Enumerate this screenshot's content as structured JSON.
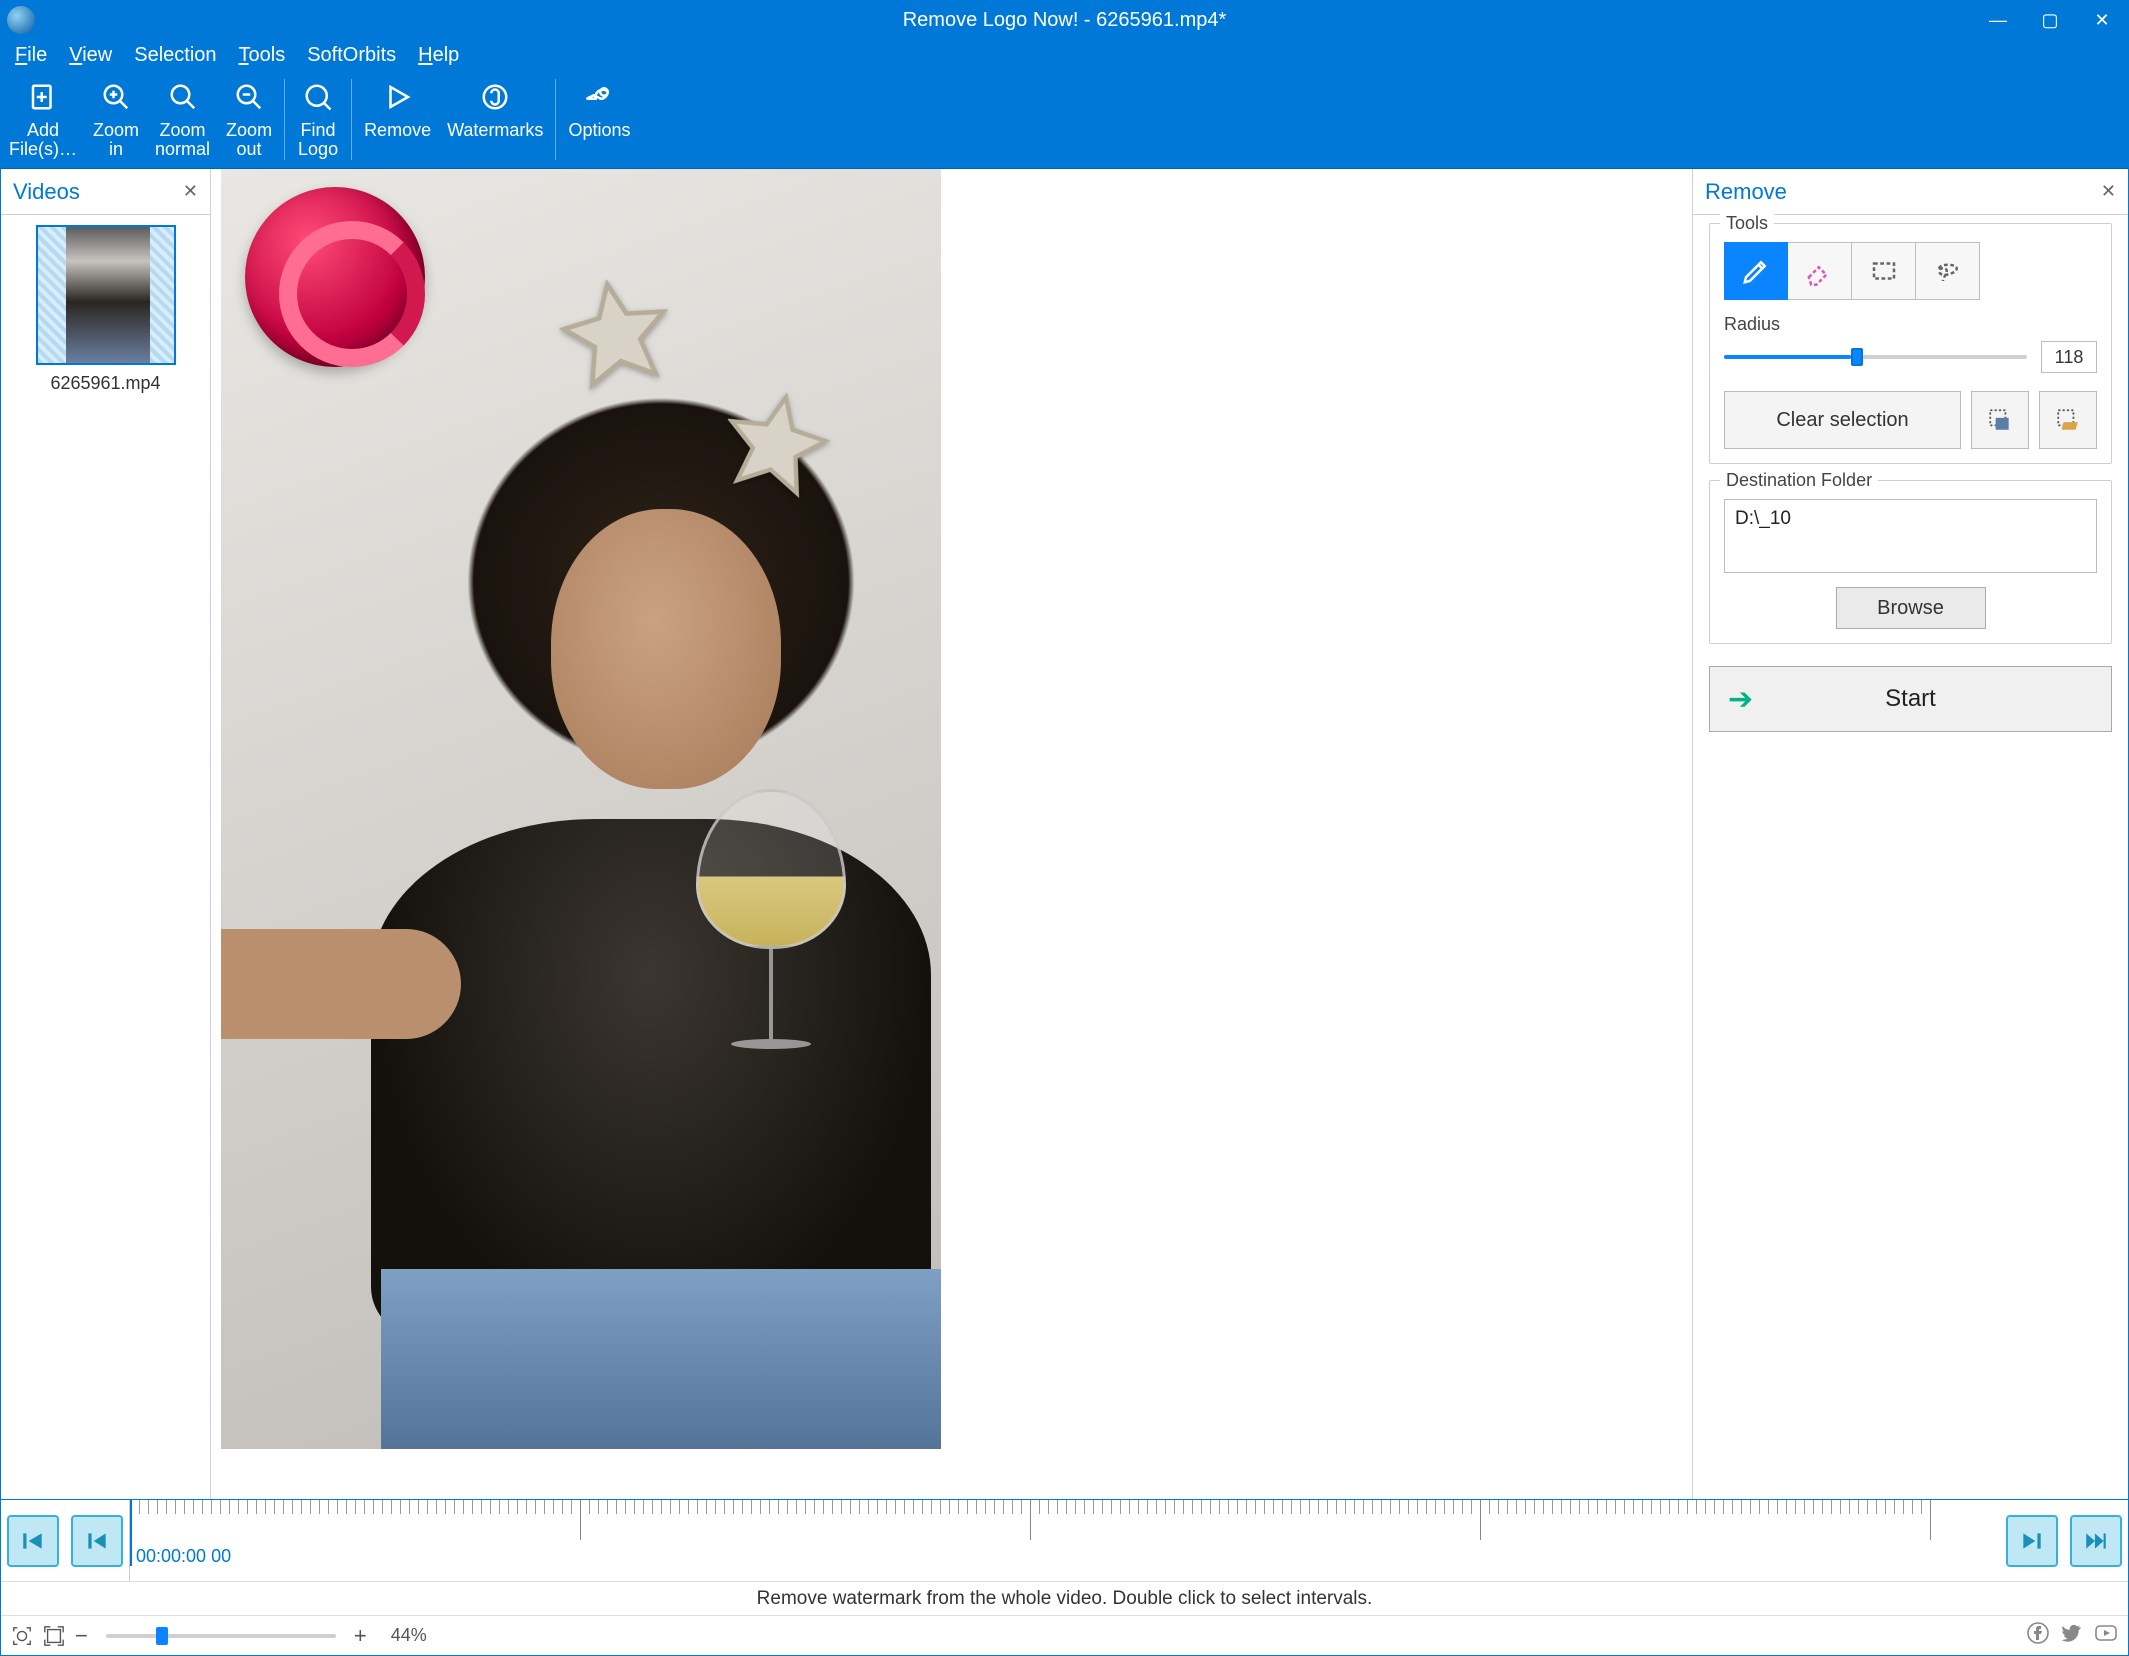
{
  "window": {
    "title": "Remove Logo Now! - 6265961.mp4*"
  },
  "menu": {
    "file": "File",
    "view": "View",
    "selection": "Selection",
    "tools": "Tools",
    "softorbits": "SoftOrbits",
    "help": "Help"
  },
  "toolbar": {
    "add_files": "Add\nFile(s)…",
    "zoom_in": "Zoom\nin",
    "zoom_normal": "Zoom\nnormal",
    "zoom_out": "Zoom\nout",
    "find_logo": "Find\nLogo",
    "remove": "Remove",
    "watermarks": "Watermarks",
    "options": "Options"
  },
  "videos": {
    "panel_title": "Videos",
    "items": [
      {
        "filename": "6265961.mp4"
      }
    ]
  },
  "remove_panel": {
    "title": "Remove",
    "tools_label": "Tools",
    "radius_label": "Radius",
    "radius_value": "118",
    "radius_percent": 42,
    "clear_selection": "Clear selection",
    "dest_label": "Destination Folder",
    "dest_path": "D:\\_10",
    "browse": "Browse",
    "start": "Start"
  },
  "timeline": {
    "time_label": "00:00:00 00",
    "hint": "Remove watermark from the whole video. Double click to select intervals."
  },
  "status": {
    "zoom_percent": "44%"
  }
}
